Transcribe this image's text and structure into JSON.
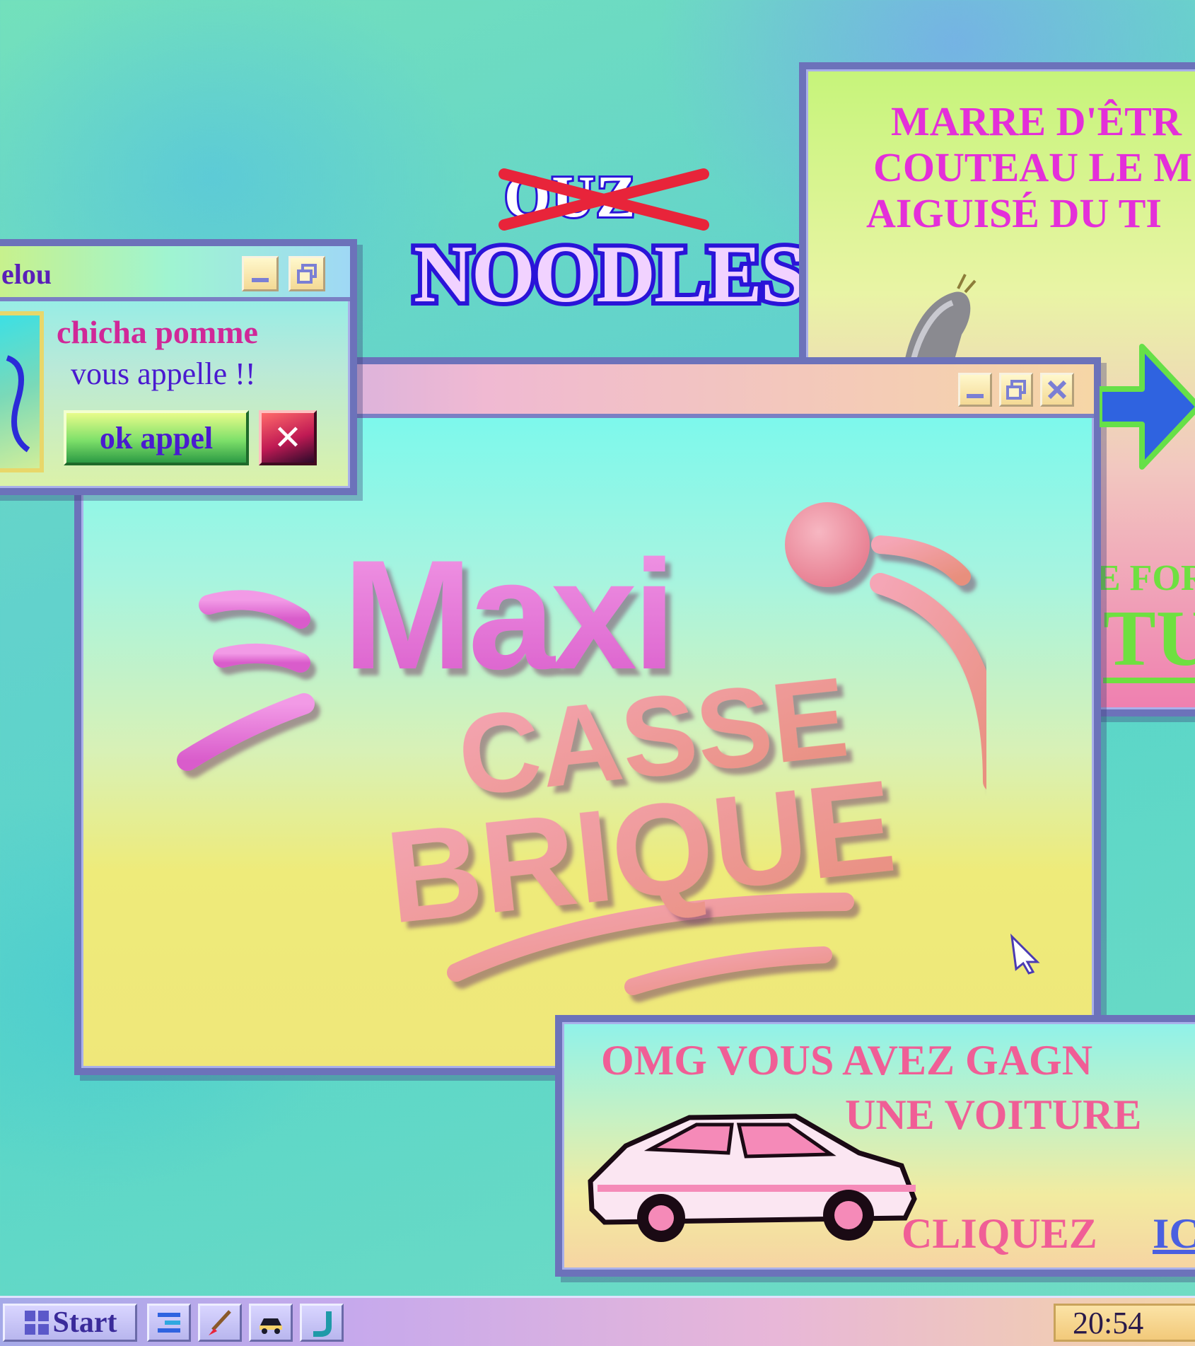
{
  "desktop": {
    "logo_struck": "OUZ",
    "logo_main": "NOODLES"
  },
  "call_popup": {
    "title": "elou",
    "message_line1": "chicha pomme",
    "message_line2": "vous appelle !!",
    "ok_label": "ok appel",
    "decline_glyph": "✕"
  },
  "knife_ad": {
    "line1": "MARRE D'ÊTR",
    "line2": "COUTEAU LE M",
    "line3": "AIGUISÉ DU TI",
    "line4": "E FOR",
    "line5": "TUI"
  },
  "game_window": {
    "logo_word1": "Maxi",
    "logo_word2": "CASSE",
    "logo_word3": "BRIQUE"
  },
  "car_ad": {
    "line1": "OMG VOUS AVEZ GAGN",
    "line2": "UNE VOITURE",
    "cta": "CLIQUEZ",
    "cta_link": "IC"
  },
  "taskbar": {
    "start_label": "Start",
    "clock": "20:54"
  }
}
